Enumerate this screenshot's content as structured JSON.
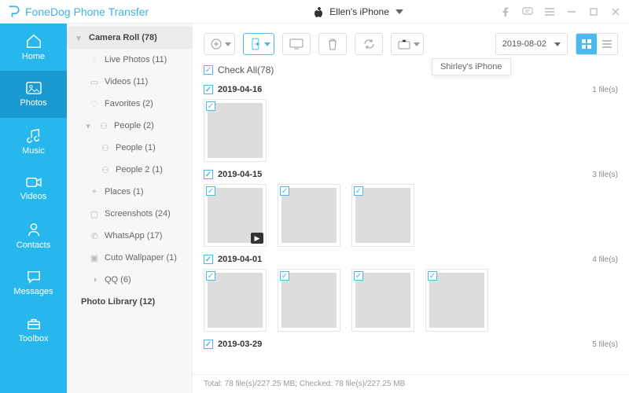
{
  "app": {
    "title": "FoneDog Phone Transfer"
  },
  "device": {
    "name": "Ellen's iPhone"
  },
  "tooltip": {
    "text": "Shirley's iPhone"
  },
  "nav": {
    "items": [
      {
        "label": "Home"
      },
      {
        "label": "Photos"
      },
      {
        "label": "Music"
      },
      {
        "label": "Videos"
      },
      {
        "label": "Contacts"
      },
      {
        "label": "Messages"
      },
      {
        "label": "Toolbox"
      }
    ]
  },
  "sidebar": {
    "camera_roll": {
      "label": "Camera Roll (78)"
    },
    "items": [
      {
        "label": "Live Photos (11)"
      },
      {
        "label": "Videos (11)"
      },
      {
        "label": "Favorites (2)"
      },
      {
        "label": "People (2)"
      },
      {
        "label": "People (1)"
      },
      {
        "label": "People 2 (1)"
      },
      {
        "label": "Places (1)"
      },
      {
        "label": "Screenshots (24)"
      },
      {
        "label": "WhatsApp (17)"
      },
      {
        "label": "Cuto Wallpaper (1)"
      },
      {
        "label": "QQ (6)"
      }
    ],
    "photo_library": {
      "label": "Photo Library (12)"
    }
  },
  "toolbar": {
    "date": "2019-08-02",
    "checkall": "Check All(78)"
  },
  "groups": [
    {
      "date": "2019-04-16",
      "count": "1 file(s)",
      "thumbs": [
        "phone"
      ]
    },
    {
      "date": "2019-04-15",
      "count": "3 file(s)",
      "thumbs": [
        "mug",
        "drinks1",
        "drinks2"
      ]
    },
    {
      "date": "2019-04-01",
      "count": "4 file(s)",
      "thumbs": [
        "dog1",
        "dog2",
        "lights",
        "drinks3"
      ]
    },
    {
      "date": "2019-03-29",
      "count": "5 file(s)",
      "thumbs": []
    }
  ],
  "footer": {
    "text": "Total: 78 file(s)/227.25 MB;  Checked: 78 file(s)/227.25 MB"
  }
}
